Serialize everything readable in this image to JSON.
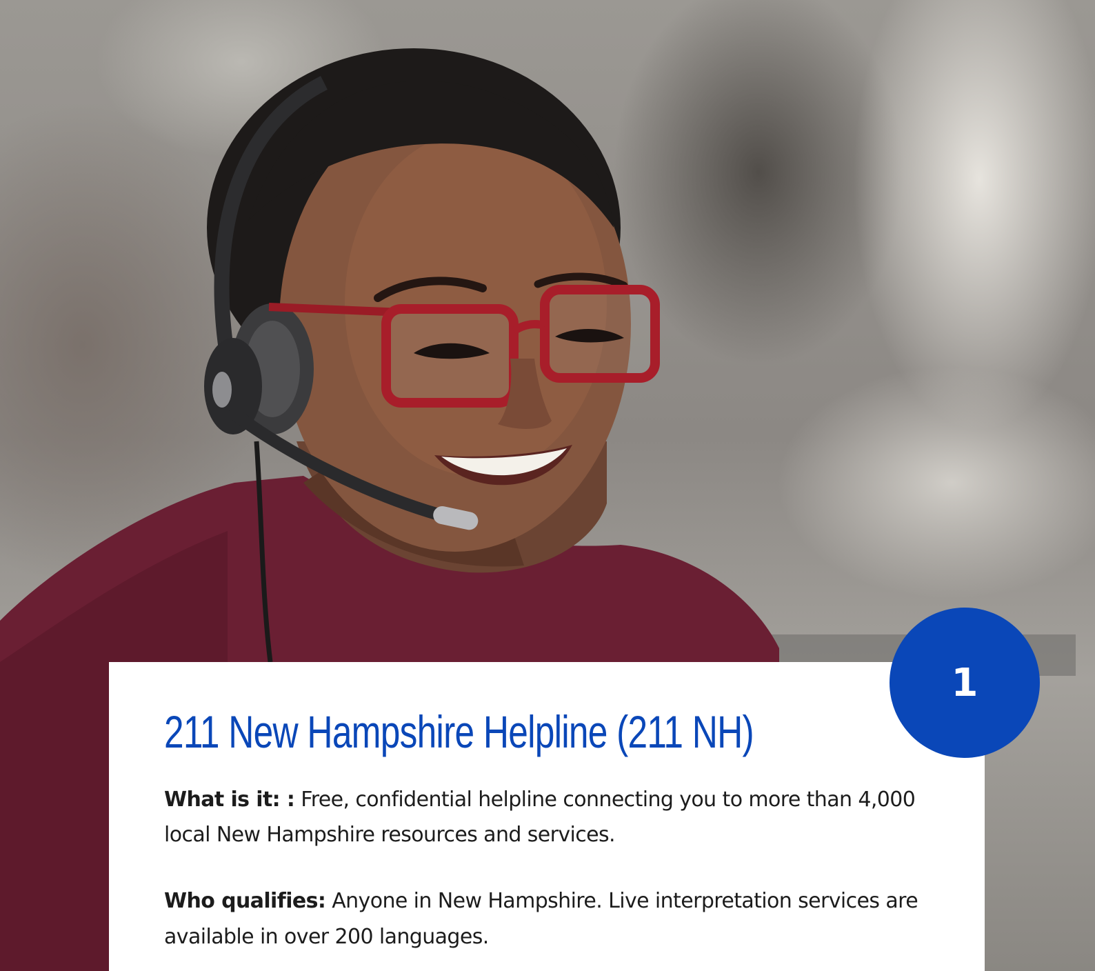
{
  "hero": {
    "image_name": "call-center-agent-with-headset-photo"
  },
  "card": {
    "title": "211 New Hampshire Helpline (211 NH)",
    "what_label": "What is it: :",
    "what_text": " Free, confidential helpline connecting you to more than 4,000 local New Hampshire resources and services.",
    "who_label": "Who qualifies:",
    "who_text": " Anyone in New Hampshire. Live interpretation services are available in over 200 languages."
  },
  "badge": {
    "number": "1"
  },
  "colors": {
    "accent": "#0a47b8",
    "card_background": "#ffffff",
    "body_text": "#1c1c1c"
  }
}
